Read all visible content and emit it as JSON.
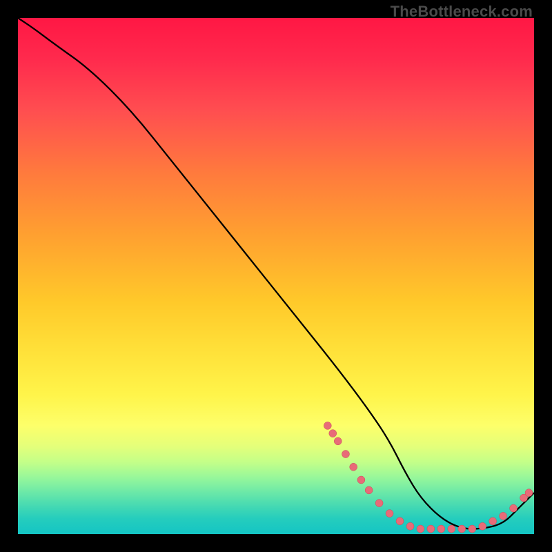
{
  "watermark": "TheBottleneck.com",
  "colors": {
    "background": "#000000",
    "curve": "#000000",
    "marker_fill": "#e86b78",
    "marker_stroke": "#c74a56"
  },
  "chart_data": {
    "type": "line",
    "title": "",
    "xlabel": "",
    "ylabel": "",
    "xlim": [
      0,
      100
    ],
    "ylim": [
      0,
      100
    ],
    "grid": false,
    "series": [
      {
        "name": "bottleneck-curve",
        "x": [
          0,
          3,
          7,
          14,
          22,
          30,
          38,
          46,
          54,
          62,
          68,
          72,
          75,
          78,
          82,
          86,
          90,
          94,
          97,
          100
        ],
        "y": [
          100,
          98,
          95,
          90,
          82,
          72,
          62,
          52,
          42,
          32,
          24,
          18,
          12,
          7,
          3,
          1,
          1,
          2,
          5,
          8
        ]
      }
    ],
    "markers": [
      {
        "x": 60,
        "y": 21
      },
      {
        "x": 61,
        "y": 19.5
      },
      {
        "x": 62,
        "y": 18
      },
      {
        "x": 63.5,
        "y": 15.5
      },
      {
        "x": 65,
        "y": 13
      },
      {
        "x": 66.5,
        "y": 10.5
      },
      {
        "x": 68,
        "y": 8.5
      },
      {
        "x": 70,
        "y": 6
      },
      {
        "x": 72,
        "y": 4
      },
      {
        "x": 74,
        "y": 2.5
      },
      {
        "x": 76,
        "y": 1.5
      },
      {
        "x": 78,
        "y": 1
      },
      {
        "x": 80,
        "y": 1
      },
      {
        "x": 82,
        "y": 1
      },
      {
        "x": 84,
        "y": 1
      },
      {
        "x": 86,
        "y": 1
      },
      {
        "x": 88,
        "y": 1
      },
      {
        "x": 90,
        "y": 1.5
      },
      {
        "x": 92,
        "y": 2.5
      },
      {
        "x": 94,
        "y": 3.5
      },
      {
        "x": 96,
        "y": 5
      },
      {
        "x": 98,
        "y": 7
      },
      {
        "x": 99,
        "y": 8
      }
    ]
  }
}
